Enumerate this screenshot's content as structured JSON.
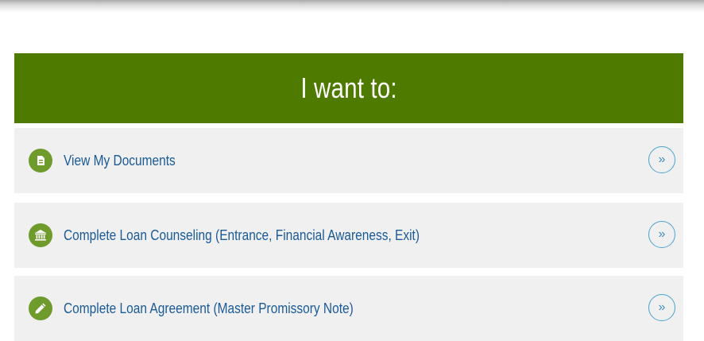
{
  "panel": {
    "title": "I want to:",
    "items": [
      {
        "label": "View My Documents",
        "icon": "document-icon"
      },
      {
        "label": "Complete Loan Counseling (Entrance, Financial Awareness, Exit)",
        "icon": "bank-icon"
      },
      {
        "label": "Complete Loan Agreement (Master Promissory Note)",
        "icon": "pencil-icon"
      }
    ],
    "chevron": "»"
  },
  "colors": {
    "header_bg": "#4e7a00",
    "icon_bg": "#6f9a2c",
    "link": "#1a5a96",
    "row_bg": "#f0f0f0",
    "chevron": "#4aa3cf"
  }
}
